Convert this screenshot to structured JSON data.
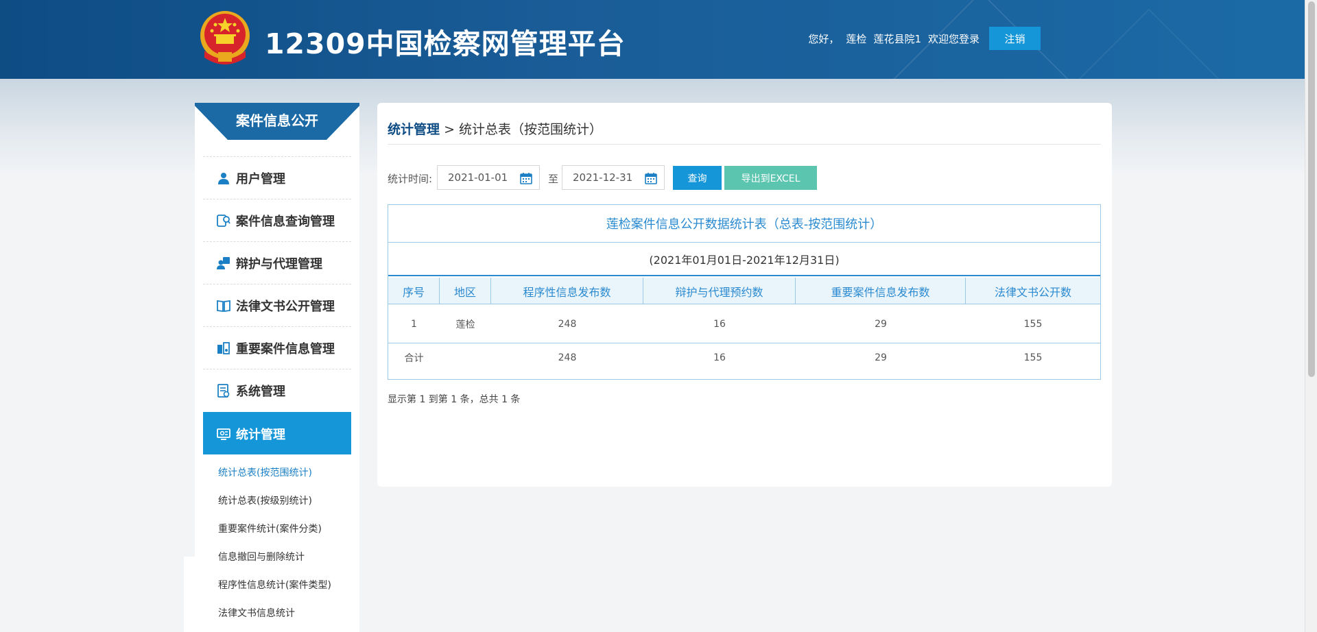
{
  "header": {
    "site_title": "12309中国检察网管理平台",
    "greeting": "您好，",
    "user_name": "莲检",
    "user_account": "莲花县院1",
    "welcome": "欢迎您登录",
    "logout_label": "注销",
    "emblem_icon": "national-emblem-icon"
  },
  "sidebar": {
    "banner": "案件信息公开",
    "items": [
      {
        "label": "用户管理",
        "icon": "user-icon"
      },
      {
        "label": "案件信息查询管理",
        "icon": "case-search-icon"
      },
      {
        "label": "辩护与代理管理",
        "icon": "lawyer-icon"
      },
      {
        "label": "法律文书公开管理",
        "icon": "book-icon"
      },
      {
        "label": "重要案件信息管理",
        "icon": "important-case-icon"
      },
      {
        "label": "系统管理",
        "icon": "system-icon"
      },
      {
        "label": "统计管理",
        "icon": "statistics-icon"
      }
    ],
    "subitems": [
      "统计总表(按范围统计)",
      "统计总表(按级别统计)",
      "重要案件统计(案件分类)",
      "信息撤回与删除统计",
      "程序性信息统计(案件类型)",
      "法律文书信息统计"
    ]
  },
  "main": {
    "breadcrumb_root": "统计管理",
    "breadcrumb_sep": ">",
    "breadcrumb_current": "统计总表（按范围统计）",
    "filter_label": "统计时间:",
    "date_from": "2021-01-01",
    "date_to_label": "至",
    "date_to": "2021-12-31",
    "query_label": "查询",
    "export_label": "导出到EXCEL",
    "table": {
      "title": "莲检案件信息公开数据统计表（总表-按范围统计）",
      "range": "(2021年01月01日-2021年12月31日)",
      "headers": [
        "序号",
        "地区",
        "程序性信息发布数",
        "辩护与代理预约数",
        "重要案件信息发布数",
        "法律文书公开数"
      ],
      "rows": [
        [
          "1",
          "莲检",
          "248",
          "16",
          "29",
          "155"
        ]
      ],
      "total": [
        "合计",
        "",
        "248",
        "16",
        "29",
        "155"
      ]
    },
    "pager": "显示第 1 到第 1 条，总共 1 条"
  },
  "colors": {
    "header_bg": "#0e4c84",
    "accent_blue": "#1596d8",
    "export_green": "#5cc5b0",
    "table_text_blue": "#2a8ad0"
  }
}
